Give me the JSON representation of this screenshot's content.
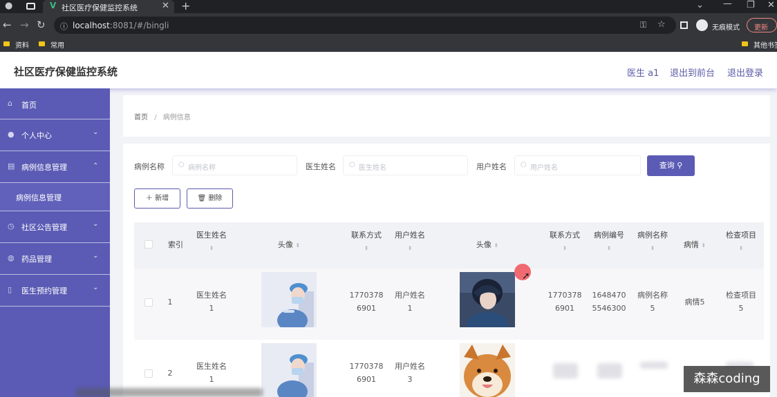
{
  "browser": {
    "tab_title": "社区医疗保健监控系统",
    "url_host": "localhost",
    "url_rest": ":8081/#/bingli",
    "profile_label": "无痕模式",
    "update_label": "更新",
    "bookmarks": [
      "资料",
      "常用"
    ],
    "other_bookmarks": "其他书签"
  },
  "header": {
    "title": "社区医疗保健监控系统",
    "user": "医生 a1",
    "back_link": "退出到前台",
    "logout_link": "退出登录"
  },
  "sidebar": {
    "items": [
      {
        "label": "首页"
      },
      {
        "label": "个人中心"
      },
      {
        "label": "病例信息管理"
      },
      {
        "label": "病例信息管理"
      },
      {
        "label": "社区公告管理"
      },
      {
        "label": "药品管理"
      },
      {
        "label": "医生预约管理"
      }
    ]
  },
  "breadcrumb": {
    "home": "首页",
    "sep": "/",
    "current": "病例信息"
  },
  "filters": {
    "case_label": "病例名称",
    "case_placeholder": "病例名称",
    "doctor_label": "医生姓名",
    "doctor_placeholder": "医生姓名",
    "user_label": "用户姓名",
    "user_placeholder": "用户姓名",
    "search_button": "查询"
  },
  "actions": {
    "add": "新增",
    "delete": "删除"
  },
  "table": {
    "headers": {
      "index": "索引",
      "doctor_name": "医生姓名",
      "avatar": "头像",
      "contact": "联系方式",
      "user_name": "用户姓名",
      "avatar2": "头像",
      "contact2": "联系方式",
      "case_no": "病例编号",
      "case_name": "病例名称",
      "condition": "病情",
      "check_items": "检查项目"
    },
    "rows": [
      {
        "index": "1",
        "doctor_name_1": "医生姓名",
        "doctor_name_2": "1",
        "contact_1": "1770378",
        "contact_2": "6901",
        "user_name_1": "用户姓名",
        "user_name_2": "1",
        "contact2_1": "1770378",
        "contact2_2": "6901",
        "case_no_1": "1648470",
        "case_no_2": "5546300",
        "case_name_1": "病例名称",
        "case_name_2": "5",
        "condition": "病情5",
        "check_1": "检查项目",
        "check_2": "5"
      },
      {
        "index": "2",
        "doctor_name_1": "医生姓名",
        "doctor_name_2": "1",
        "contact_1": "1770378",
        "contact_2": "6901",
        "user_name_1": "用户姓名",
        "user_name_2": "3"
      }
    ]
  },
  "watermark": "森森coding",
  "colors": {
    "primary": "#5b5bb5",
    "sidebar_bg": "#5b5bb5",
    "cursor": "#f05a63"
  }
}
